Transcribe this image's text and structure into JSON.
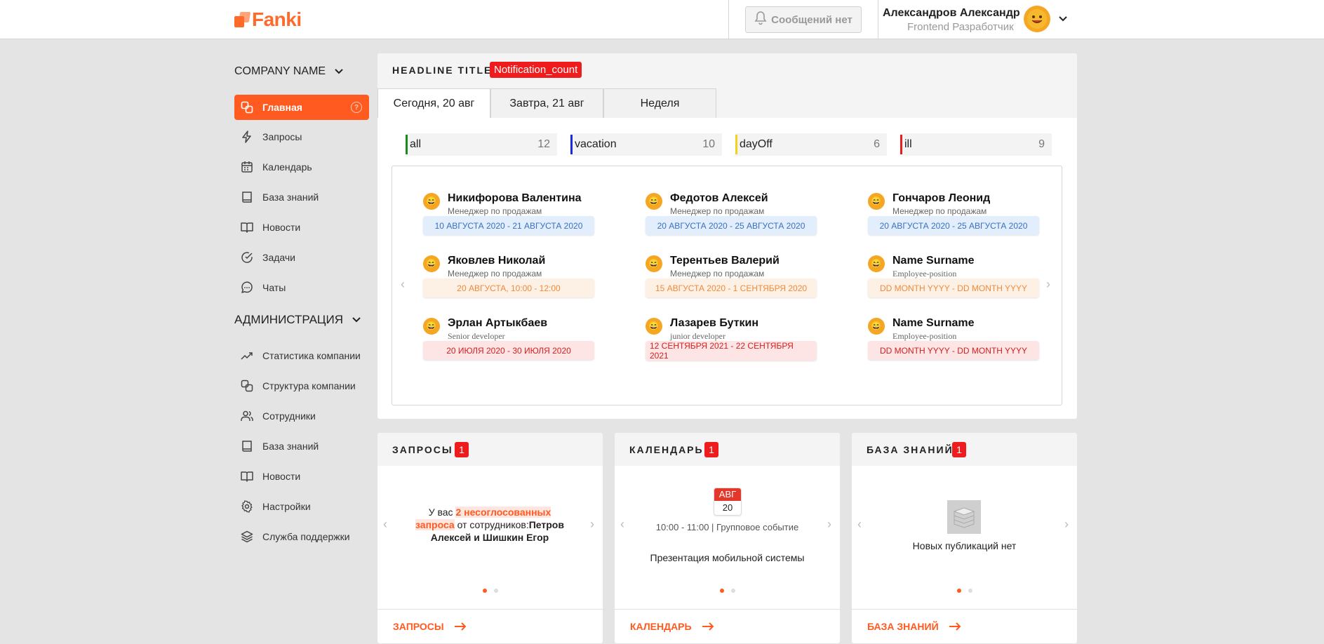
{
  "header": {
    "logo_text": "Fanki",
    "notifications_label": "Сообщений нет",
    "user_name": "Александров Александр",
    "user_role": "Frontend Разработчик"
  },
  "sidebar": {
    "company_name": "COMPANY NAME",
    "main_items": [
      {
        "label": "Главная",
        "icon": "home-icon",
        "active": true
      },
      {
        "label": "Запросы",
        "icon": "lightning-icon"
      },
      {
        "label": "Календарь",
        "icon": "calendar-icon"
      },
      {
        "label": "База знаний",
        "icon": "book-icon"
      },
      {
        "label": "Новости",
        "icon": "open-book-icon"
      },
      {
        "label": "Задачи",
        "icon": "check-circle-icon"
      },
      {
        "label": "Чаты",
        "icon": "chat-icon"
      }
    ],
    "admin_title": "АДМИНИСТРАЦИЯ",
    "admin_items": [
      {
        "label": "Статистика компании",
        "icon": "trend-icon"
      },
      {
        "label": "Структура компании",
        "icon": "structure-icon"
      },
      {
        "label": "Сотрудники",
        "icon": "users-icon"
      },
      {
        "label": "База знаний",
        "icon": "book-icon"
      },
      {
        "label": "Новости",
        "icon": "open-book-icon"
      },
      {
        "label": "Настройки",
        "icon": "gear-icon"
      },
      {
        "label": "Служба поддержки",
        "icon": "layers-icon"
      }
    ]
  },
  "main": {
    "headline": "HEADLINE TITLE",
    "notification_badge": "Notification_count",
    "tabs": [
      {
        "label": "Сегодня, 20 авг",
        "active": true
      },
      {
        "label": "Завтра, 21 авг"
      },
      {
        "label": "Неделя"
      }
    ],
    "stats": [
      {
        "label": "all",
        "count": "12",
        "color": "#1a8a1a"
      },
      {
        "label": "vacation",
        "count": "10",
        "color": "#1a2ae0"
      },
      {
        "label": "dayOff",
        "count": "6",
        "color": "#f2d21a"
      },
      {
        "label": "ill",
        "count": "9",
        "color": "#e81c1c"
      }
    ],
    "people": [
      {
        "name": "Никифорова Валентина",
        "position": "Менеджер по продажам",
        "dates": "10 АВГУСТА 2020 - 21 АВГУСТА 2020",
        "type": "blue"
      },
      {
        "name": "Федотов Алексей",
        "position": "Менеджер по продажам",
        "dates": "20 АВГУСТА 2020 - 25 АВГУСТА 2020",
        "type": "blue"
      },
      {
        "name": "Гончаров Леонид",
        "position": "Менеджер по продажам",
        "dates": "20 АВГУСТА 2020 - 25 АВГУСТА 2020",
        "type": "blue"
      },
      {
        "name": "Яковлев Николай",
        "position": "Менеджер по продажам",
        "dates": "20 АВГУСТА, 10:00 - 12:00",
        "type": "orange"
      },
      {
        "name": "Терентьев Валерий",
        "position": "Менеджер по продажам",
        "dates": "15 АВГУСТА 2020 - 1 СЕНТЯБРЯ 2020",
        "type": "orange"
      },
      {
        "name": "Name Surname",
        "position": "Employee-position",
        "dates": "DD MONTH YYYY - DD MONTH YYYY",
        "type": "orange"
      },
      {
        "name": "Эрлан Артыкбаев",
        "position": "Senior developer",
        "dates": "20 ИЮЛЯ 2020 - 30 ИЮЛЯ 2020",
        "type": "red"
      },
      {
        "name": "Лазарев Буткин",
        "position": "junior developer",
        "dates": "12 СЕНТЯБРЯ 2021 - 22 СЕНТЯБРЯ 2021",
        "type": "red"
      },
      {
        "name": "Name Surname",
        "position": "Employee-position",
        "dates": "DD MONTH YYYY - DD MONTH YYYY",
        "type": "red"
      }
    ]
  },
  "requests": {
    "title": "ЗАПРОСЫ",
    "badge": "1",
    "text_prefix": "У вас",
    "text_highlight": "2 несоглосованных запроса",
    "text_middle": "от сотрудников:",
    "text_names": "Петров Алексей и Шишкин Егор",
    "footer": "ЗАПРОСЫ"
  },
  "calendar": {
    "title": "КАЛЕНДАРЬ",
    "badge": "1",
    "month": "АВГ",
    "day": "20",
    "time": "10:00 - 11:00 | Групповое событие",
    "event": "Презентация мобильной системы",
    "footer": "КАЛЕНДАРЬ"
  },
  "knowledge": {
    "title": "БАЗА ЗНАНИЙ",
    "badge": "1",
    "empty_text": "Новых публикаций нет",
    "footer": "БАЗА ЗНАНИЙ"
  },
  "colors": {
    "accent": "#ff5a1f",
    "badge_red": "#ee1c1c"
  }
}
